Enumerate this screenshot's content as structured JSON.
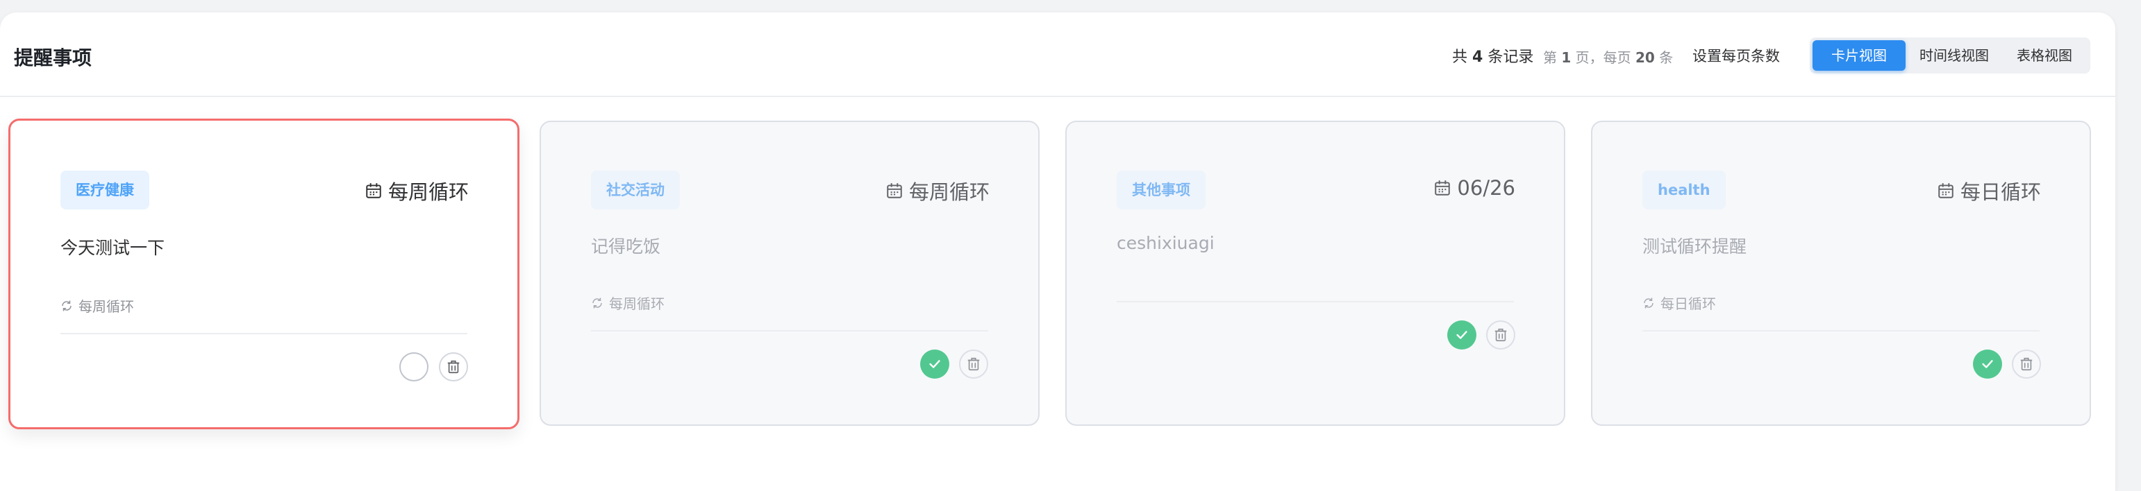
{
  "header": {
    "title": "提醒事项",
    "record_prefix": "共",
    "record_count": "4",
    "record_suffix": "条记录",
    "page_prefix": "第",
    "page_number": "1",
    "page_middle": "页，每页",
    "page_size": "20",
    "page_suffix": "条",
    "set_page_size": "设置每页条数"
  },
  "views": {
    "card": "卡片视图",
    "timeline": "时间线视图",
    "table": "表格视图",
    "active": "card"
  },
  "colors": {
    "accent": "#2d8cf0",
    "selected_border": "#f56c6c",
    "done_green": "#52c890",
    "tag_blue": "#4fa3f7"
  },
  "cards": [
    {
      "tag": "医疗健康",
      "date": "每周循环",
      "title": "今天测试一下",
      "repeat": "每周循环",
      "completed": false,
      "selected": true
    },
    {
      "tag": "社交活动",
      "date": "每周循环",
      "title": "记得吃饭",
      "repeat": "每周循环",
      "completed": true,
      "selected": false
    },
    {
      "tag": "其他事项",
      "date": "06/26",
      "title": "ceshixiuagi",
      "repeat": "",
      "completed": true,
      "selected": false
    },
    {
      "tag": "health",
      "date": "每日循环",
      "title": "测试循环提醒",
      "repeat": "每日循环",
      "completed": true,
      "selected": false
    }
  ],
  "icons": {
    "date": "calendar-icon",
    "repeat": "refresh-icon",
    "complete": "check-icon",
    "delete": "trash-icon"
  }
}
